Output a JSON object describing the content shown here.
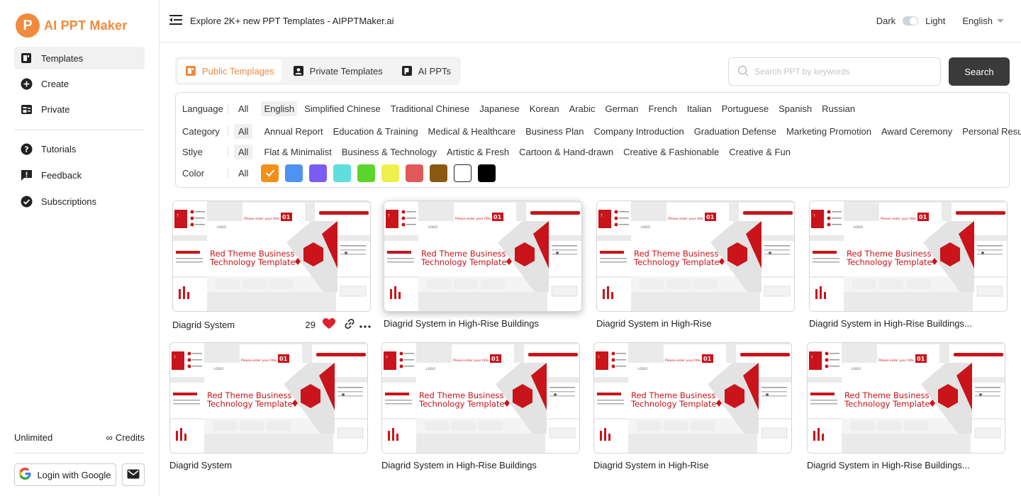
{
  "app": {
    "logo_letter": "P",
    "name": "AI PPT Maker",
    "brand_color": "#f08a3c"
  },
  "sidebar": {
    "main_items": [
      {
        "label": "Templates",
        "icon": "templates-icon",
        "active": true
      },
      {
        "label": "Create",
        "icon": "plus-circle-icon",
        "active": false
      },
      {
        "label": "Private",
        "icon": "private-icon",
        "active": false
      }
    ],
    "secondary_items": [
      {
        "label": "Tutorials",
        "icon": "help-circle-icon"
      },
      {
        "label": "Feedback",
        "icon": "feedback-icon"
      },
      {
        "label": "Subscriptions",
        "icon": "check-circle-icon"
      }
    ],
    "plan": "Unlimited",
    "credits_symbol": "∞",
    "credits_label": "Credits",
    "login_label": "Login with Google"
  },
  "header": {
    "title": "Explore 2K+ new PPT Templates  - AIPPTMaker.ai",
    "dark_label": "Dark",
    "light_label": "Light",
    "language": "English"
  },
  "tabs": [
    {
      "label": "Public Templages",
      "active": true
    },
    {
      "label": "Private Templates",
      "active": false
    },
    {
      "label": "AI PPTs",
      "active": false
    }
  ],
  "search": {
    "placeholder": "Search PPT by keywords",
    "button": "Search"
  },
  "filters": {
    "language": {
      "label": "Language",
      "all": "All",
      "options": [
        "English",
        "Simplified Chinese",
        "Traditional Chinese",
        "Japanese",
        "Korean",
        "Arabic",
        "German",
        "French",
        "Italian",
        "Portuguese",
        "Spanish",
        "Russian"
      ],
      "selected": "English"
    },
    "category": {
      "label": "Category",
      "all": "All",
      "options": [
        "Annual Report",
        "Education & Training",
        "Medical & Healthcare",
        "Business Plan",
        "Company Introduction",
        "Graduation Defense",
        "Marketing Promotion",
        "Award Ceremony",
        "Personal Resume"
      ]
    },
    "style": {
      "label": "Stlye",
      "all": "All",
      "options": [
        "Flat & Minimalist",
        "Business & Technology",
        "Artistic & Fresh",
        "Cartoon & Hand-drawn",
        "Creative & Fashionable",
        "Creative & Fun"
      ]
    },
    "color": {
      "label": "Color",
      "all": "All",
      "swatches": [
        "#f39019",
        "#4f93f2",
        "#7a5cf0",
        "#5fdede",
        "#5ad62c",
        "#eef14d",
        "#e25858",
        "#8b5a10",
        "#ffffff",
        "#000000"
      ],
      "selected_index": 0
    }
  },
  "thumbnail": {
    "line1": "Red Theme Business",
    "line2": "Technology Template",
    "logo": "LOGO",
    "number": "01",
    "slide_title": "Please enter your title."
  },
  "cards": [
    {
      "title": "Diagrid System",
      "likes": "29"
    },
    {
      "title": "Diagrid System in High-Rise Buildings"
    },
    {
      "title": "Diagrid System in High-Rise"
    },
    {
      "title": "Diagrid System in High-Rise Buildings..."
    },
    {
      "title": "Diagrid System"
    },
    {
      "title": "Diagrid System in High-Rise Buildings"
    },
    {
      "title": "Diagrid System in High-Rise"
    },
    {
      "title": "Diagrid System in High-Rise Buildings..."
    }
  ]
}
